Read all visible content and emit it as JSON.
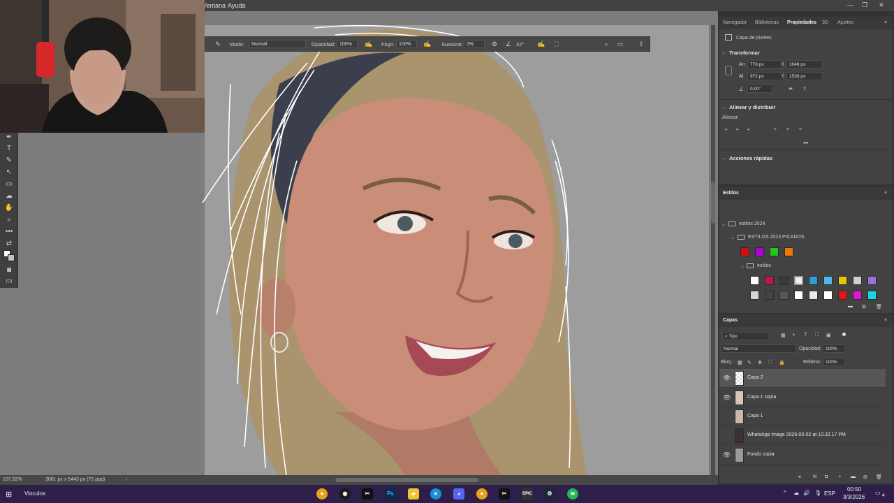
{
  "menu": {
    "items": [
      "Ventana",
      "Ayuda"
    ],
    "window_controls": [
      "—",
      "❐",
      "✕"
    ]
  },
  "options_bar": {
    "modo_label": "Modo:",
    "modo_value": "Normal",
    "opacidad_label": "Opacidad:",
    "opacidad_value": "100%",
    "flujo_label": "Flujo:",
    "flujo_value": "100%",
    "suavizar_label": "Suavizar:",
    "suavizar_value": "0%",
    "angle_value": "42°"
  },
  "status": {
    "zoom": "107,52%",
    "doc_size": "3061 px x 5443 px (72 ppp)"
  },
  "properties_panel": {
    "tabs": [
      "Navegador",
      "Bibliotecas",
      "Propiedades",
      "3D",
      "Ajustes"
    ],
    "active_tab": "Propiedades",
    "layer_type": "Capa de píxeles",
    "transform": {
      "title": "Transformar",
      "an_label": "An",
      "an_value": "776 px",
      "x_label": "X",
      "x_value": "1048 px",
      "al_label": "Al",
      "al_value": "972 px",
      "y_label": "Y",
      "y_value": "1536 px",
      "angle_value": "0,00°"
    },
    "align": {
      "title": "Alinear y distribuir",
      "subtitle": "Alinear:"
    },
    "quick_actions": "Acciones rápidas",
    "more": "•••"
  },
  "styles_panel": {
    "title": "Estilos",
    "group": "estilos 2024",
    "subgroup": "ESTILOS 2023 PICADOS",
    "folder": "estilos",
    "swatch_colors_row1": [
      "#d01010",
      "#b400d8",
      "#1ec81e",
      "#e87a00"
    ]
  },
  "layers_panel": {
    "title": "Capas",
    "filter": "Tipo",
    "blend_mode": "Normal",
    "opacidad_label": "Opacidad:",
    "opacidad_value": "100%",
    "bloq_label": "Bloq.:",
    "relleno_label": "Relleno:",
    "relleno_value": "100%",
    "layers": [
      {
        "name": "Capa 2",
        "visible": true,
        "selected": true
      },
      {
        "name": "Capa 1 copia",
        "visible": true,
        "selected": false
      },
      {
        "name": "Capa 1",
        "visible": false,
        "selected": false
      },
      {
        "name": "WhatsApp Image 2026-03-02 at 10.32.17 PM",
        "visible": false,
        "selected": false
      },
      {
        "name": "Fondo copia",
        "visible": true,
        "selected": false
      }
    ]
  },
  "taskbar": {
    "label": "Vinculos",
    "time": "00:50",
    "date": "3/3/2026",
    "lang": "ESP",
    "notifications": "4",
    "apps": [
      "chrome-icon",
      "obs-icon",
      "capcut-icon",
      "photoshop-icon",
      "explorer-icon",
      "edge-icon",
      "discord-icon",
      "chrome-icon",
      "capcut-icon",
      "epic-icon",
      "steam-icon",
      "spotify-icon"
    ]
  }
}
